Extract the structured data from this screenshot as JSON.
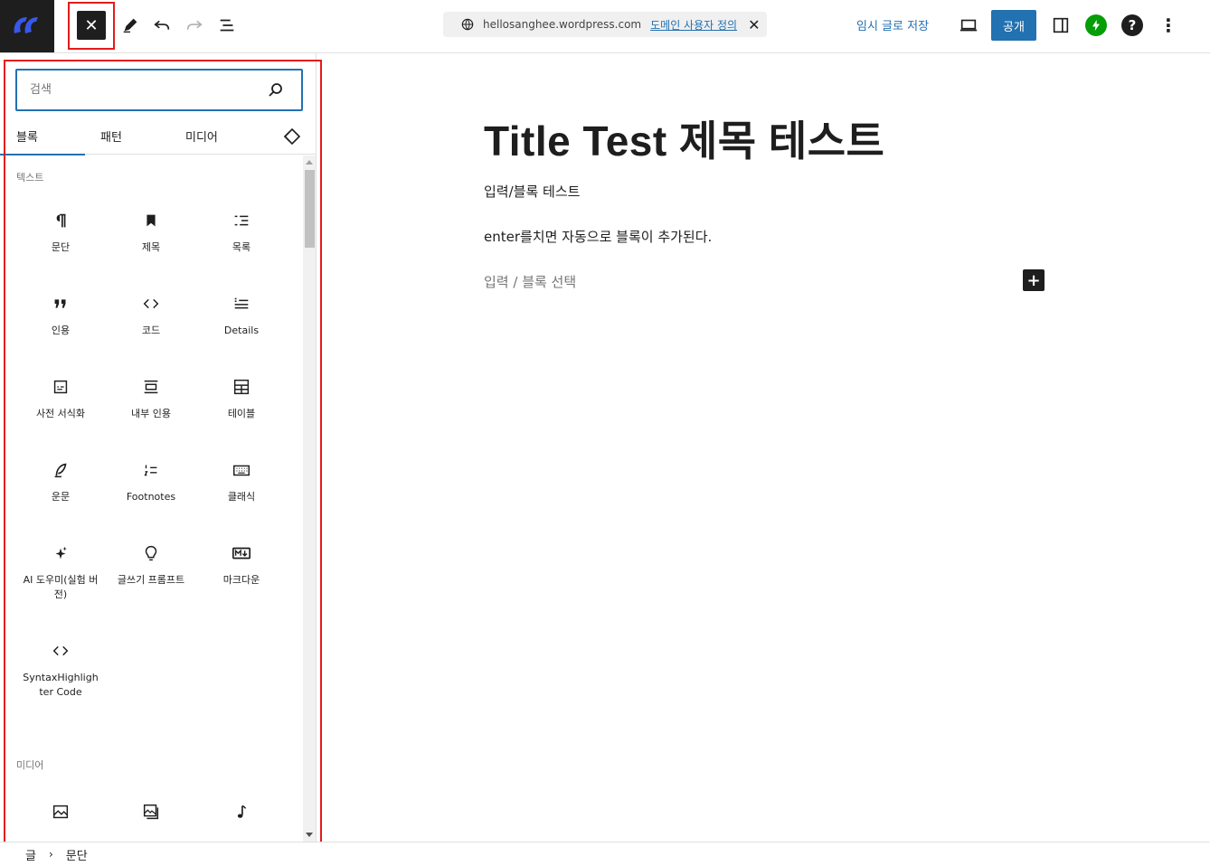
{
  "topbar": {
    "close_symbol": "✕",
    "site_url": "hellosanghee.wordpress.com",
    "domain_link": "도메인 사용자 정의",
    "doc_close": "✕",
    "save_draft": "임시 글로 저장",
    "publish": "공개",
    "help": "?",
    "more": "⋮"
  },
  "inserter": {
    "search_placeholder": "검색",
    "tabs": [
      {
        "label": "블록"
      },
      {
        "label": "패턴"
      },
      {
        "label": "미디어"
      }
    ],
    "categories": {
      "text": "텍스트",
      "media": "미디어"
    },
    "text_blocks": [
      {
        "label": "문단",
        "icon": "paragraph-icon"
      },
      {
        "label": "제목",
        "icon": "heading-bookmark-icon"
      },
      {
        "label": "목록",
        "icon": "list-icon"
      },
      {
        "label": "인용",
        "icon": "quote-icon"
      },
      {
        "label": "코드",
        "icon": "code-icon"
      },
      {
        "label": "Details",
        "icon": "details-icon"
      },
      {
        "label": "사전 서식화",
        "icon": "preformatted-icon"
      },
      {
        "label": "내부 인용",
        "icon": "pullquote-icon"
      },
      {
        "label": "테이블",
        "icon": "table-icon"
      },
      {
        "label": "운문",
        "icon": "verse-feather-icon"
      },
      {
        "label": "Footnotes",
        "icon": "footnotes-icon"
      },
      {
        "label": "클래식",
        "icon": "keyboard-icon"
      },
      {
        "label": "AI 도우미(실험 버전)",
        "icon": "sparkle-icon"
      },
      {
        "label": "글쓰기 프롬프트",
        "icon": "lightbulb-icon"
      },
      {
        "label": "마크다운",
        "icon": "markdown-icon"
      },
      {
        "label": "SyntaxHighlighter Code",
        "icon": "code-icon"
      }
    ],
    "media_blocks": [
      {
        "label": "",
        "icon": "image-icon"
      },
      {
        "label": "",
        "icon": "gallery-icon"
      },
      {
        "label": "",
        "icon": "audio-icon"
      }
    ]
  },
  "canvas": {
    "title": "Title Test 제목 테스트",
    "paragraphs": [
      "입력/블록 테스트",
      "enter를치면 자동으로 블록이 추가된다."
    ],
    "placeholder": "입력 / 블록 선택",
    "add_block": "+"
  },
  "footer": {
    "crumbs": [
      "글",
      "문단"
    ],
    "separator": "›"
  },
  "colors": {
    "accent": "#2271b1",
    "dark": "#1e1e1e",
    "highlight": "#e31b1b",
    "jetpack": "#069e08"
  }
}
